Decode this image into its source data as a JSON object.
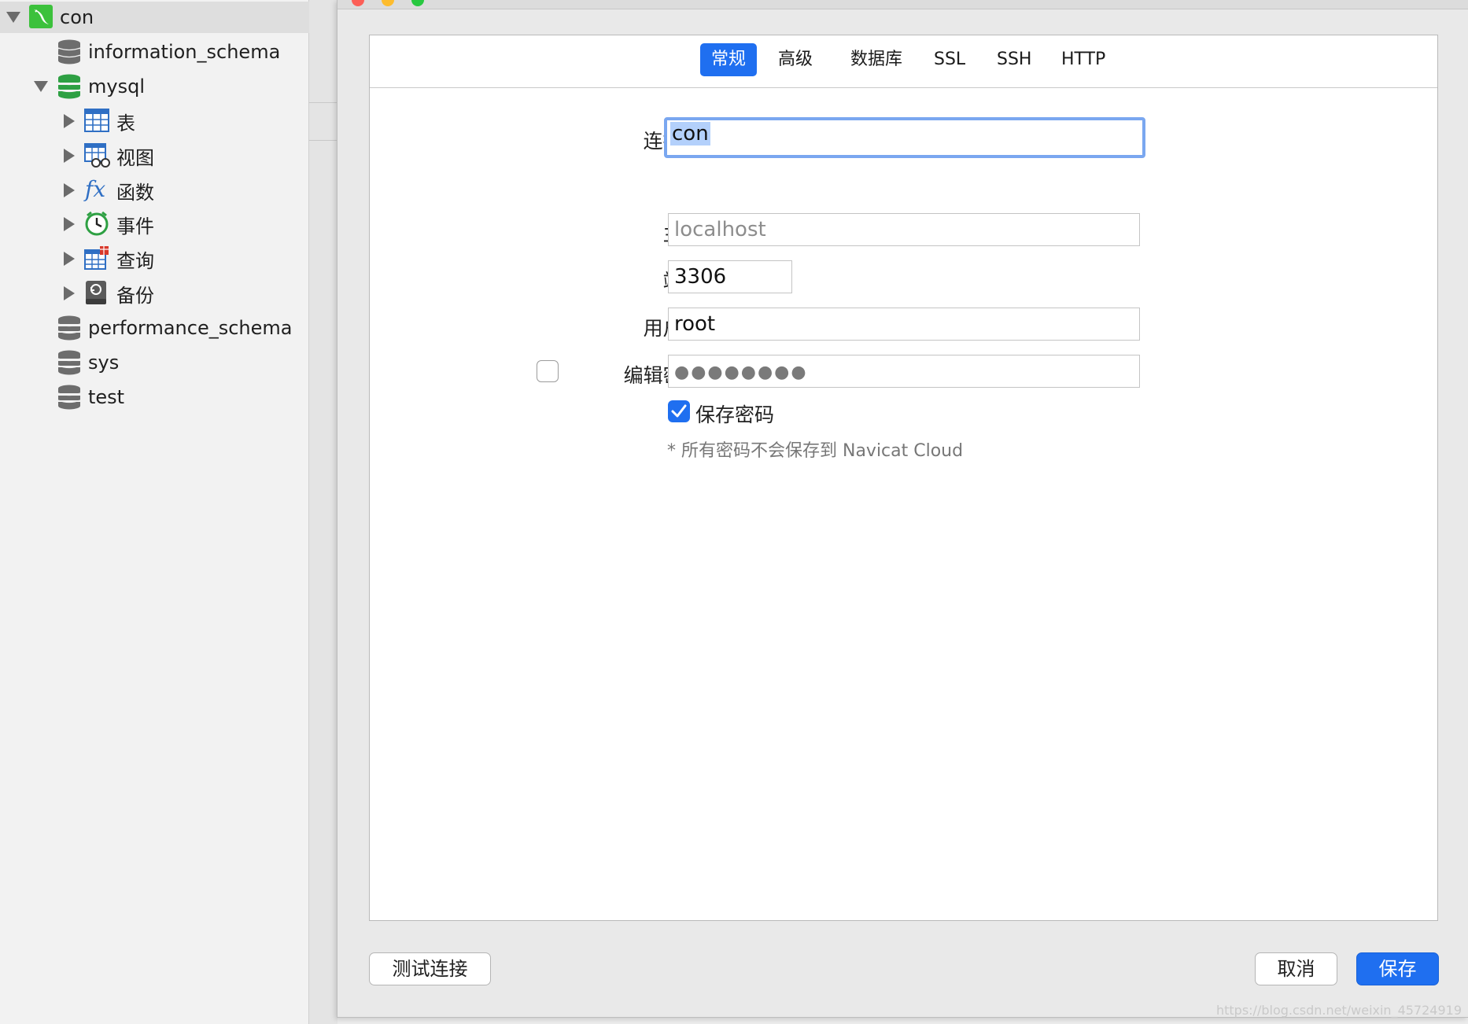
{
  "sidebar": {
    "connection": {
      "label": "con"
    },
    "databases": [
      {
        "label": "information_schema"
      },
      {
        "label": "mysql",
        "children": [
          {
            "label": "表",
            "icon": "table-icon"
          },
          {
            "label": "视图",
            "icon": "view-icon"
          },
          {
            "label": "函数",
            "icon": "function-icon"
          },
          {
            "label": "事件",
            "icon": "event-clock-icon"
          },
          {
            "label": "查询",
            "icon": "query-icon"
          },
          {
            "label": "备份",
            "icon": "backup-icon"
          }
        ]
      },
      {
        "label": "performance_schema"
      },
      {
        "label": "sys"
      },
      {
        "label": "test"
      }
    ]
  },
  "dialog": {
    "tabs": [
      {
        "label": "常规",
        "active": true
      },
      {
        "label": "高级"
      },
      {
        "label": "数据库"
      },
      {
        "label": "SSL"
      },
      {
        "label": "SSH"
      },
      {
        "label": "HTTP"
      }
    ],
    "form": {
      "connection_name_label": "连接名:",
      "connection_name_value": "con",
      "host_label": "主机:",
      "host_value": "localhost",
      "port_label": "端口:",
      "port_value": "3306",
      "username_label": "用户名:",
      "username_value": "root",
      "edit_password_label": "编辑密码:",
      "edit_password_checked": false,
      "password_mask": "●●●●●●●●",
      "save_password_label": "保存密码",
      "save_password_checked": true,
      "note": "* 所有密码不会保存到 Navicat Cloud"
    },
    "buttons": {
      "test_connection": "测试连接",
      "cancel": "取消",
      "save": "保存"
    }
  },
  "watermark": "https://blog.csdn.net/weixin_45724919",
  "colors": {
    "accent": "#1f6ff0",
    "db_active": "#2ea043",
    "db_inactive": "#6d6d6d",
    "connection_icon": "#3cc13c"
  }
}
